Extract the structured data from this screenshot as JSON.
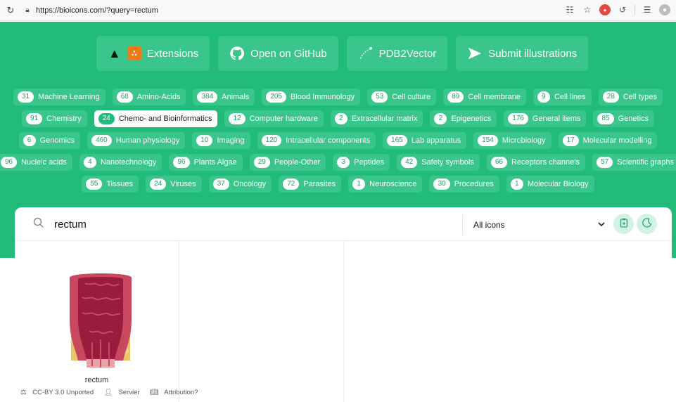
{
  "browser": {
    "url": "https://bioicons.com/?query=rectum"
  },
  "top_buttons": [
    {
      "label": "Extensions"
    },
    {
      "label": "Open on GitHub"
    },
    {
      "label": "PDB2Vector"
    },
    {
      "label": "Submit illustrations"
    }
  ],
  "tag_rows": [
    [
      {
        "count": "31",
        "label": "Machine Learning"
      },
      {
        "count": "68",
        "label": "Amino-Acids"
      },
      {
        "count": "384",
        "label": "Animals"
      },
      {
        "count": "205",
        "label": "Blood Immunology"
      },
      {
        "count": "53",
        "label": "Cell culture"
      },
      {
        "count": "89",
        "label": "Cell membrane"
      },
      {
        "count": "9",
        "label": "Cell lines"
      },
      {
        "count": "28",
        "label": "Cell types"
      }
    ],
    [
      {
        "count": "91",
        "label": "Chemistry"
      },
      {
        "count": "24",
        "label": "Chemo- and Bioinformatics",
        "active": true
      },
      {
        "count": "12",
        "label": "Computer hardware"
      },
      {
        "count": "2",
        "label": "Extracellular matrix"
      },
      {
        "count": "2",
        "label": "Epigenetics"
      },
      {
        "count": "176",
        "label": "General items"
      },
      {
        "count": "85",
        "label": "Genetics"
      }
    ],
    [
      {
        "count": "6",
        "label": "Genomics"
      },
      {
        "count": "460",
        "label": "Human physiology"
      },
      {
        "count": "10",
        "label": "Imaging"
      },
      {
        "count": "120",
        "label": "Intracellular components"
      },
      {
        "count": "165",
        "label": "Lab apparatus"
      },
      {
        "count": "154",
        "label": "Microbiology"
      },
      {
        "count": "17",
        "label": "Molecular modelling"
      }
    ],
    [
      {
        "count": "96",
        "label": "Nucleic acids"
      },
      {
        "count": "4",
        "label": "Nanotechnology"
      },
      {
        "count": "96",
        "label": "Plants Algae"
      },
      {
        "count": "29",
        "label": "People-Other"
      },
      {
        "count": "3",
        "label": "Peptides"
      },
      {
        "count": "42",
        "label": "Safety symbols"
      },
      {
        "count": "66",
        "label": "Receptors channels"
      },
      {
        "count": "57",
        "label": "Scientific graphs"
      }
    ],
    [
      {
        "count": "55",
        "label": "Tissues"
      },
      {
        "count": "24",
        "label": "Viruses"
      },
      {
        "count": "37",
        "label": "Oncology"
      },
      {
        "count": "72",
        "label": "Parasites"
      },
      {
        "count": "1",
        "label": "Neuroscience"
      },
      {
        "count": "30",
        "label": "Procedures"
      },
      {
        "count": "1",
        "label": "Molecular Biology"
      }
    ]
  ],
  "search": {
    "value": "rectum",
    "select_value": "All icons"
  },
  "result": {
    "name": "rectum",
    "license": "CC-BY 3.0 Unported",
    "author": "Servier",
    "attribution": "Attribution?"
  },
  "colors": {
    "brand_green": "#21bb7a",
    "button_green": "#3ac58a"
  }
}
